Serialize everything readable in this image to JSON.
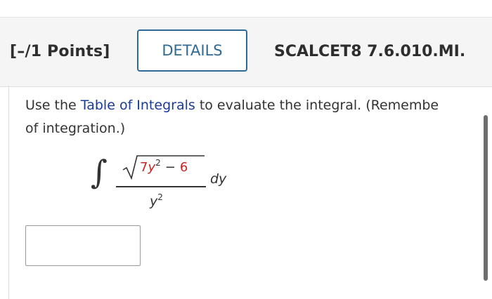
{
  "header": {
    "points": "[–/1 Points]",
    "details_label": "DETAILS",
    "problem_code": "SCALCET8 7.6.010.MI."
  },
  "instructions": {
    "before_link": "Use the ",
    "link_text": "Table of Integrals",
    "after_link": " to evaluate the integral. (Remembe",
    "line2": "of integration.)"
  },
  "integral": {
    "sign": "∫",
    "coefficient": "7",
    "variable": "y",
    "exponent": "2",
    "minus": "−",
    "constant": "6",
    "differential": "dy",
    "denominator_var": "y",
    "denominator_exp": "2"
  },
  "answer": {
    "value": ""
  },
  "colors": {
    "accent": "#2f6a97",
    "link": "#1a3c96",
    "highlight": "#cc2222"
  }
}
